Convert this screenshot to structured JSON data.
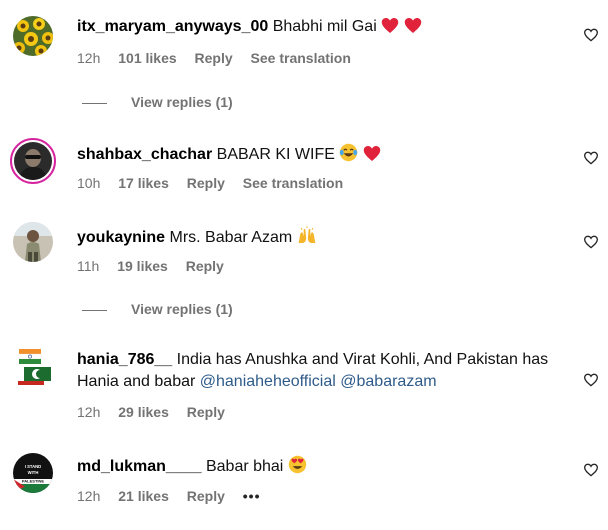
{
  "comments": [
    {
      "username": "itx_maryam_anyways_00",
      "text": "Bhabhi mil Gai",
      "emoji": [
        "red-heart",
        "red-heart"
      ],
      "time": "12h",
      "likes": "101 likes",
      "reply": "Reply",
      "translation": "See translation",
      "view_replies": "View replies (1)"
    },
    {
      "username": "shahbax_chachar",
      "text": "BABAR KI WIFE",
      "emoji": [
        "tears-of-joy",
        "red-heart"
      ],
      "time": "10h",
      "likes": "17 likes",
      "reply": "Reply",
      "translation": "See translation"
    },
    {
      "username": "youkaynine",
      "text": "Mrs. Babar Azam",
      "emoji": [
        "raising-hands"
      ],
      "time": "11h",
      "likes": "19 likes",
      "reply": "Reply",
      "view_replies": "View replies (1)"
    },
    {
      "username": "hania_786__",
      "text": "India has Anushka and Virat Kohli, And Pakistan has Hania and babar",
      "mentions": [
        "@haniaheheofficial",
        "@babarazam"
      ],
      "time": "12h",
      "likes": "29 likes",
      "reply": "Reply"
    },
    {
      "username": "md_lukman____",
      "text": "Babar bhai",
      "emoji": [
        "heart-eyes"
      ],
      "time": "12h",
      "likes": "21 likes",
      "reply": "Reply",
      "more": "•••",
      "avatar_text": "STAND WITH PALESTINE"
    }
  ],
  "colors": {
    "meta": "#737373",
    "heart": "#e0233b",
    "mention": "#2f5b8a",
    "story_ring": "#d6249f"
  }
}
